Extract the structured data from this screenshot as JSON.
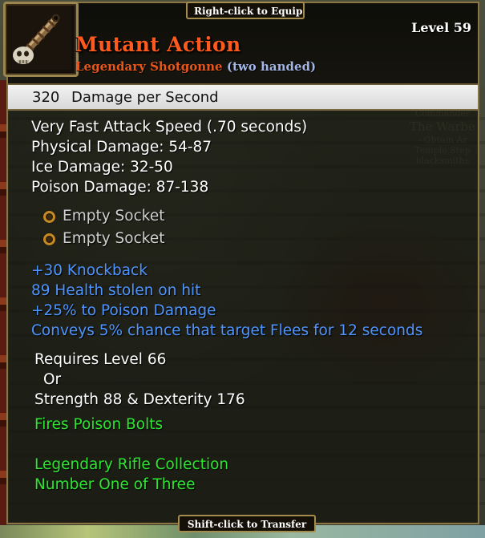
{
  "prompts": {
    "equip": "Right-click to Equip",
    "transfer": "Shift-click to Transfer"
  },
  "item": {
    "name": "Mutant Action",
    "rarity": "Legendary Shotgonne",
    "hands": "(two handed)",
    "level": "Level 59",
    "icon": "bone-shotgonne-icon",
    "name_color": "#ff5a1e"
  },
  "dps": {
    "value": "320",
    "label": "Damage per Second"
  },
  "stats": [
    "Very Fast Attack Speed (.70 seconds)",
    "Physical Damage: 54-87",
    "Ice Damage: 32-50",
    "Poison Damage: 87-138"
  ],
  "sockets": [
    "Empty Socket",
    "Empty Socket"
  ],
  "enchants": [
    "+30 Knockback",
    "89 Health stolen on hit",
    "+25% to Poison Damage",
    "Conveys 5% chance that target Flees for 12 seconds"
  ],
  "requirements": {
    "level": "Requires Level 66",
    "or": "Or",
    "stats": "Strength 88 & Dexterity 176"
  },
  "special": "Fires Poison Bolts",
  "collection": {
    "name": "Legendary Rifle Collection",
    "position": "Number One of Three"
  },
  "colors": {
    "enchant_blue": "#4e95ff",
    "special_green": "#2ee631",
    "frame_gold": "#8a7644"
  }
}
